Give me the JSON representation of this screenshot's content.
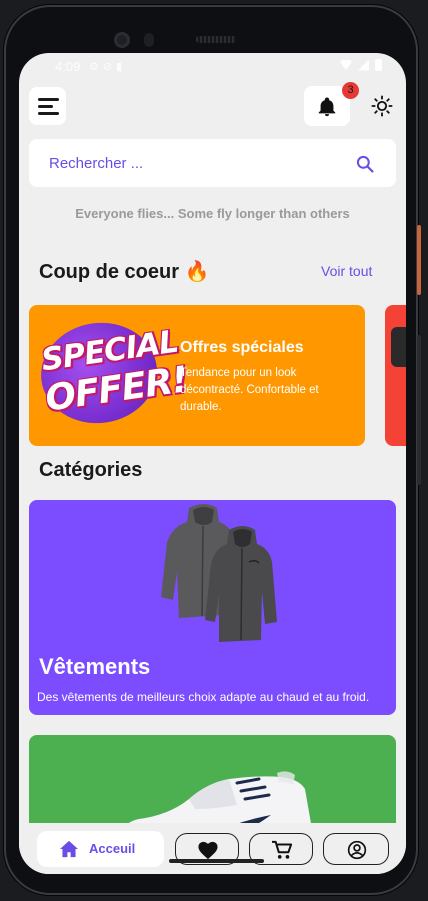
{
  "status_bar": {
    "time": "4:09"
  },
  "header": {
    "notification_count": "3"
  },
  "search": {
    "placeholder": "Rechercher ..."
  },
  "tagline": "Everyone flies... Some fly longer than others",
  "featured": {
    "title": "Coup de coeur",
    "title_emoji": "🔥",
    "see_all": "Voir tout",
    "offers": [
      {
        "badge_line1": "SPECIAL",
        "badge_line2": "OFFER!",
        "title": "Offres spéciales",
        "description": "Tendance pour un look décontracté. Confortable et durable.",
        "color": "#ff9800"
      },
      {
        "color": "#f44336"
      }
    ]
  },
  "categories": {
    "title": "Catégories",
    "items": [
      {
        "name": "Vêtements",
        "description": "Des vêtements de meilleurs choix adapte au chaud et au froid.",
        "color": "#7c4dff"
      },
      {
        "color": "#4caf50"
      }
    ]
  },
  "nav": {
    "home_label": "Acceuil",
    "items": [
      "home-icon",
      "heart-icon",
      "cart-icon",
      "account-icon"
    ]
  },
  "colors": {
    "accent": "#6b4de6",
    "badge": "#e53935"
  }
}
